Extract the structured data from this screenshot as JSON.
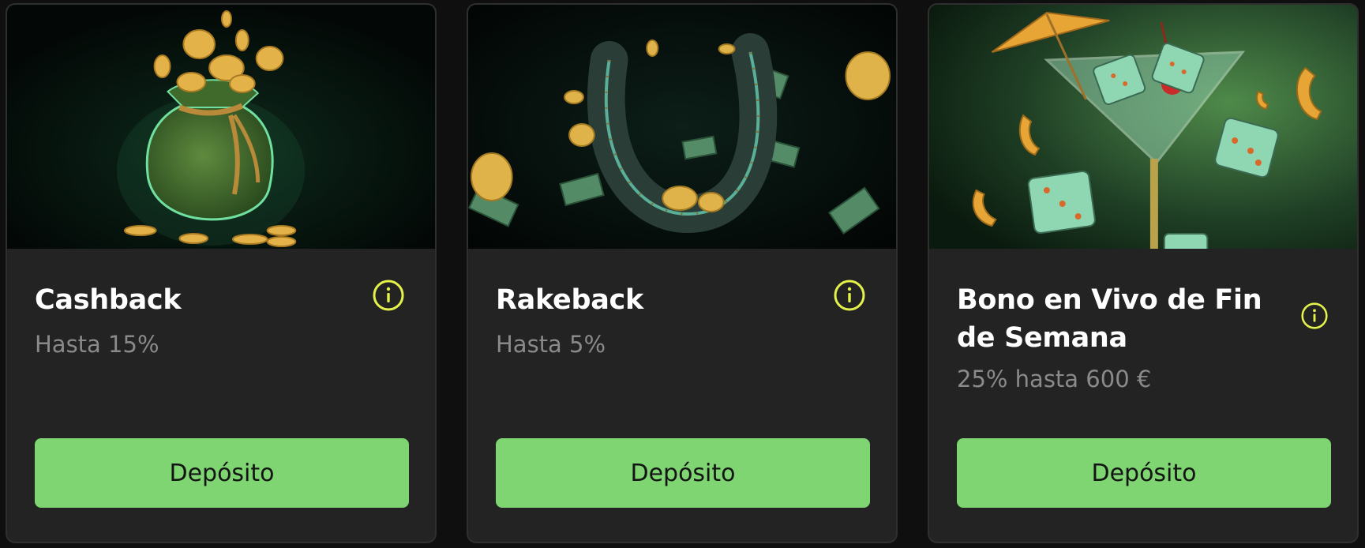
{
  "colors": {
    "background": "#0f0f0f",
    "card": "#232323",
    "accent_button": "#7ed572",
    "info_icon": "#e4f24a",
    "title": "#ffffff",
    "subtitle": "#8a8a8a"
  },
  "cards": [
    {
      "image": "money-bag-with-gold-coins",
      "title": "Cashback",
      "subtitle": "Hasta 15%",
      "info_icon": "info-circle-icon",
      "button_label": "Depósito"
    },
    {
      "image": "horseshoe-with-banknotes-and-coins",
      "title": "Rakeback",
      "subtitle": "Hasta 5%",
      "info_icon": "info-circle-icon",
      "button_label": "Depósito"
    },
    {
      "image": "martini-glass-with-dice-and-umbrella",
      "title": "Bono en Vivo de Fin de Semana",
      "subtitle": "25% hasta 600 €",
      "info_icon": "info-circle-icon",
      "button_label": "Depósito"
    }
  ]
}
